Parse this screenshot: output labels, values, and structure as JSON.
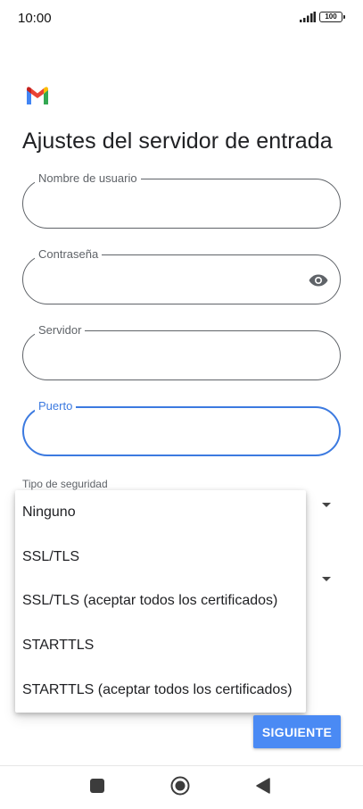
{
  "status_bar": {
    "time": "10:00",
    "battery": "100"
  },
  "app": {
    "logo": "gmail-logo",
    "title": "Ajustes del servidor de entrada"
  },
  "form": {
    "username": {
      "label": "Nombre de usuario",
      "value": ""
    },
    "password": {
      "label": "Contraseña",
      "value": "",
      "icon": "eye-icon"
    },
    "server": {
      "label": "Servidor",
      "value": ""
    },
    "port": {
      "label": "Puerto",
      "value": "",
      "state": "focused"
    },
    "security_type": {
      "label": "Tipo de seguridad"
    }
  },
  "dropdown": {
    "options": [
      "Ninguno",
      "SSL/TLS",
      "SSL/TLS (aceptar todos los certificados)",
      "STARTTLS",
      "STARTTLS (aceptar todos los certificados)"
    ]
  },
  "actions": {
    "next_label": "SIGUIENTE"
  },
  "navigation_bar": {
    "recents": "square-icon",
    "home": "circle-icon",
    "back": "back-triangle-icon"
  },
  "colors": {
    "accent": "#3c7ae0",
    "button": "#4a8af4",
    "outline": "#5f6368"
  }
}
